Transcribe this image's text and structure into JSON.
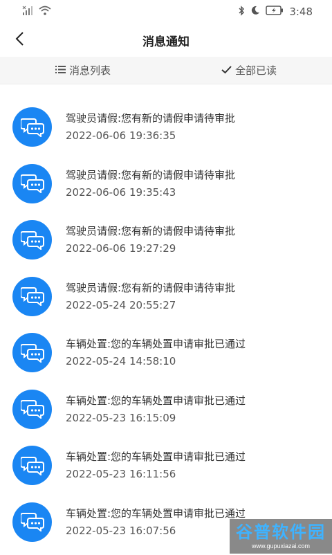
{
  "status_bar": {
    "time": "3:48",
    "icons": [
      "signal-icon",
      "wifi-icon",
      "bluetooth-icon",
      "moon-icon",
      "battery-icon"
    ]
  },
  "header": {
    "title": "消息通知",
    "back_icon": "chevron-left-icon"
  },
  "toolbar": {
    "list_label": "消息列表",
    "list_icon": "list-icon",
    "read_all_label": "全部已读",
    "read_all_icon": "check-icon"
  },
  "colors": {
    "accent": "#1a86f3",
    "toolbar_bg": "#f6f6f6"
  },
  "notifications": [
    {
      "message": "驾驶员请假:您有新的请假申请待审批",
      "time": "2022-06-06 19:36:35"
    },
    {
      "message": "驾驶员请假:您有新的请假申请待审批",
      "time": "2022-06-06 19:35:43"
    },
    {
      "message": "驾驶员请假:您有新的请假申请待审批",
      "time": "2022-06-06 19:27:29"
    },
    {
      "message": "驾驶员请假:您有新的请假申请待审批",
      "time": "2022-05-24 20:55:27"
    },
    {
      "message": "车辆处置:您的车辆处置申请审批已通过",
      "time": "2022-05-24 14:58:10"
    },
    {
      "message": "车辆处置:您的车辆处置申请审批已通过",
      "time": "2022-05-23 16:15:09"
    },
    {
      "message": "车辆处置:您的车辆处置申请审批已通过",
      "time": "2022-05-23 16:11:56"
    },
    {
      "message": "车辆处置:您的车辆处置申请审批已通过",
      "time": "2022-05-23 16:07:56"
    }
  ],
  "watermark": {
    "title": "谷普软件园",
    "url": "www.gupuxiazai.com"
  }
}
